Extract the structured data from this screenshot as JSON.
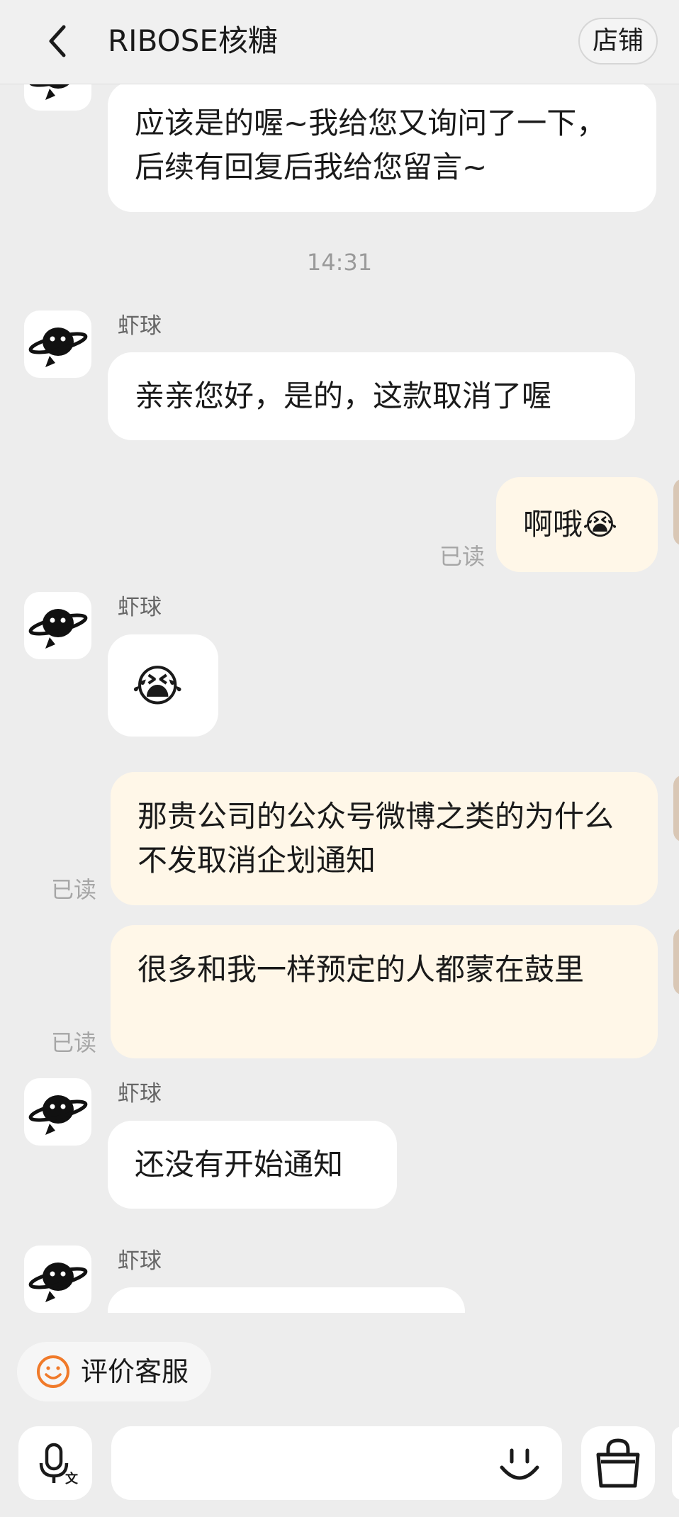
{
  "header": {
    "title": "RIBOSE核糖",
    "store_label": "店铺"
  },
  "chat": {
    "agent_name": "虾球",
    "messages": [
      {
        "from": "agent",
        "text": "应该是的喔~我给您又询问了一下，后续有回复后我给您留言~"
      },
      {
        "time": "14:31"
      },
      {
        "from": "agent",
        "name": "虾球",
        "text": "亲亲您好，是的，这款取消了喔"
      },
      {
        "from": "me",
        "text": "啊哦😭",
        "status": "已读"
      },
      {
        "from": "agent",
        "name": "虾球",
        "text": "😭"
      },
      {
        "from": "me",
        "text": "那贵公司的公众号微博之类的为什么不发取消企划通知",
        "status": "已读"
      },
      {
        "from": "me",
        "text": "很多和我一样预定的人都蒙在鼓里",
        "status": "已读"
      },
      {
        "from": "agent",
        "name": "虾球",
        "text": "还没有开始通知"
      },
      {
        "from": "agent",
        "name": "虾球",
        "text": ""
      }
    ]
  },
  "footer": {
    "rate_label": "评价客服",
    "input_value": "",
    "icons": [
      "smile-icon",
      "microphone-translate-icon",
      "emoji-icon",
      "shopping-bag-icon"
    ]
  },
  "colors": {
    "background": "#ededed",
    "incoming_bubble": "#ffffff",
    "outgoing_bubble": "#fff7e8",
    "rate_icon": "#f07a2a"
  }
}
